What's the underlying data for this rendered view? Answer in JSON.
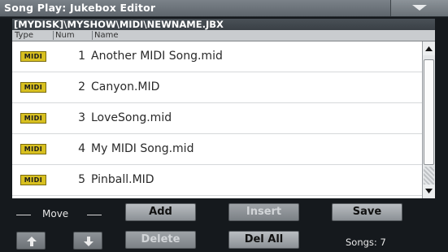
{
  "window": {
    "title": "Song Play: Jukebox Editor"
  },
  "menu_icon": "chevron-down-icon",
  "path": "[MYDISK]\\MYSHOW\\MIDI\\NEWNAME.JBX",
  "columns": [
    "Type",
    "Num",
    "Name"
  ],
  "rows": [
    {
      "type": "MIDI",
      "num": "1",
      "name": "Another MIDI Song.mid"
    },
    {
      "type": "MIDI",
      "num": "2",
      "name": "Canyon.MID"
    },
    {
      "type": "MIDI",
      "num": "3",
      "name": "LoveSong.mid"
    },
    {
      "type": "MIDI",
      "num": "4",
      "name": "My MIDI Song.mid"
    },
    {
      "type": "MIDI",
      "num": "5",
      "name": "Pinball.MID"
    }
  ],
  "controls": {
    "move_label": "Move",
    "add": "Add",
    "insert": "Insert",
    "save": "Save",
    "delete": "Delete",
    "del_all": "Del All",
    "songs_count": "Songs: 7"
  },
  "colors": {
    "midi_badge": "#d8c020",
    "background": "#15191d"
  }
}
